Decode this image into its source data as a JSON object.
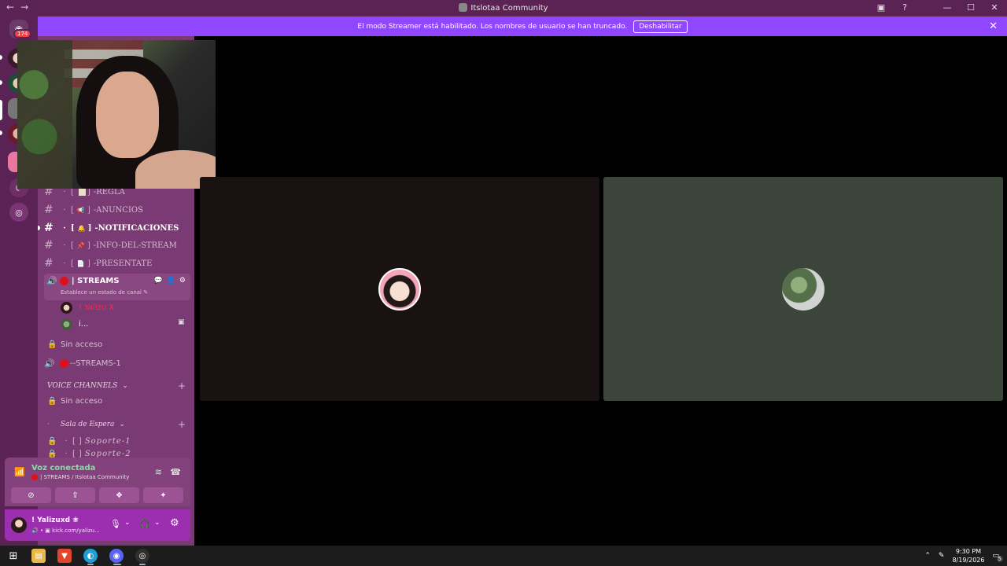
{
  "window": {
    "title": "Itslotaa Community",
    "back": "←",
    "forward": "→",
    "inbox_icon": "▣",
    "help_icon": "?",
    "minimize": "—",
    "maximize": "☐",
    "close": "✕"
  },
  "banner": {
    "text": "El modo Streamer está habilitado. Los nombres de usuario se han truncado.",
    "button": "Deshabilitar",
    "close": "✕"
  },
  "rail": {
    "home_icon": "◉",
    "badge": "174",
    "explore_icon": "◎",
    "moon_icon": "☾"
  },
  "channels": [
    {
      "name": "-REGLA",
      "icon": "▯"
    },
    {
      "name": "-ANUNCIOS",
      "icon": "📢"
    },
    {
      "name": "-NOTIFICACIONES",
      "icon": "🔔"
    },
    {
      "name": "-INFO-DEL-STREAM",
      "icon": "📌"
    },
    {
      "name": "-PRESENTATE",
      "icon": "📄"
    }
  ],
  "channel_symbols": {
    "hash": "#",
    "dot": "·",
    "bracket_open": "[",
    "bracket_close": "]"
  },
  "voice_channel": {
    "name": "| STREAMS",
    "status": "Establece un estado de canal ✎",
    "speaker_icon": "🔊",
    "chat_icon": "💬",
    "invite_icon": "👤",
    "settings_icon": "⚙",
    "users": [
      {
        "name": "! Yalizu X",
        "color": "#ff2a40"
      },
      {
        "name": "i...",
        "color": "#ffffff"
      }
    ],
    "screen_icon": "▣"
  },
  "locked_1": "Sin acceso",
  "lock_icon": "🔒",
  "streams1": "--STREAMS-1",
  "category_voice": "VOICE CHANNELS",
  "locked_2": "Sin acceso",
  "category_espera": "Sala de Espera",
  "category_plus": "+",
  "category_chevron": "⌄",
  "soporte_1": "Soporte-1",
  "soporte_2": "Soporte-2",
  "voice_panel": {
    "signal_icon": "📶",
    "title": "Voz conectada",
    "subtitle": "| STREAMS / Itslotaa Community",
    "wave_icon": "≋",
    "hangup_icon": "☎",
    "buttons": [
      {
        "name": "camera-off",
        "icon": "⊘"
      },
      {
        "name": "screen-share",
        "icon": "⇪"
      },
      {
        "name": "activities",
        "icon": "❖"
      },
      {
        "name": "soundboard",
        "icon": "✦"
      }
    ]
  },
  "user_panel": {
    "name": "! Yalizuxd ❀",
    "status": "🔊 • ▣ kick.com/yalizu...",
    "mic_icon": "🎙",
    "headset_icon": "🎧",
    "settings_icon": "⚙",
    "chevron": "⌄"
  },
  "taskbar": {
    "start_icon": "⊞",
    "apps": [
      {
        "name": "file-explorer",
        "icon": "▤",
        "color": "#e8b84a"
      },
      {
        "name": "brave",
        "icon": "▼",
        "color": "#e2452c"
      },
      {
        "name": "edge",
        "icon": "◐",
        "color": "#1f9fd9"
      },
      {
        "name": "discord",
        "icon": "◉",
        "color": "#5865f2"
      },
      {
        "name": "obs",
        "icon": "◎",
        "color": "#303030"
      }
    ],
    "tray_chevron": "⌃",
    "pen_icon": "✎",
    "time": "9:30 PM",
    "date": "8/19/2026",
    "notif_icon": "▭",
    "notif_count": "5"
  }
}
